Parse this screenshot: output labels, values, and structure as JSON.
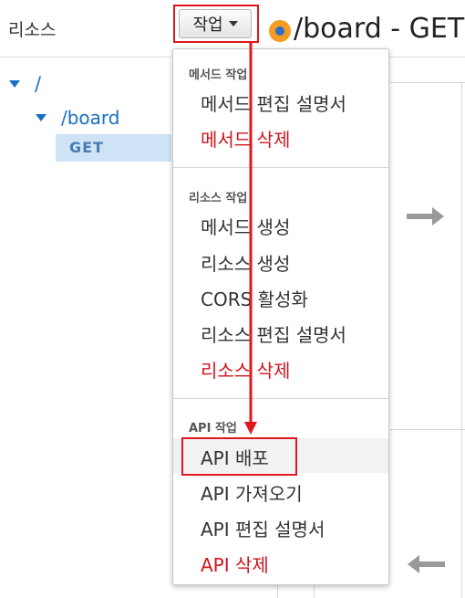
{
  "resources": {
    "title": "리소스",
    "tree": {
      "root": "/",
      "board": "/board",
      "method": "GET"
    }
  },
  "header": {
    "actions_label": "작업",
    "page_title": "/board - GET"
  },
  "menu": {
    "method_section": {
      "heading": "메서드 작업",
      "items": [
        "메서드 편집 설명서",
        "메서드 삭제"
      ]
    },
    "resource_section": {
      "heading": "리소스 작업",
      "items": [
        "메서드 생성",
        "리소스 생성",
        "CORS 활성화",
        "리소스 편집 설명서",
        "리소스 삭제"
      ]
    },
    "api_section": {
      "heading": "API 작업",
      "items": [
        "API 배포",
        "API 가져오기",
        "API 편집 설명서",
        "API 삭제"
      ]
    }
  },
  "colors": {
    "link_blue": "#1a6fc4",
    "danger_red": "#d0141c",
    "highlight_red": "#e0171c",
    "method_orange": "#f39c1f",
    "selected_bg": "#cfe3f7"
  },
  "icons": {
    "expand": "triangle-down-icon",
    "dropdown": "caret-down-icon",
    "method_status": "status-dot-icon"
  }
}
